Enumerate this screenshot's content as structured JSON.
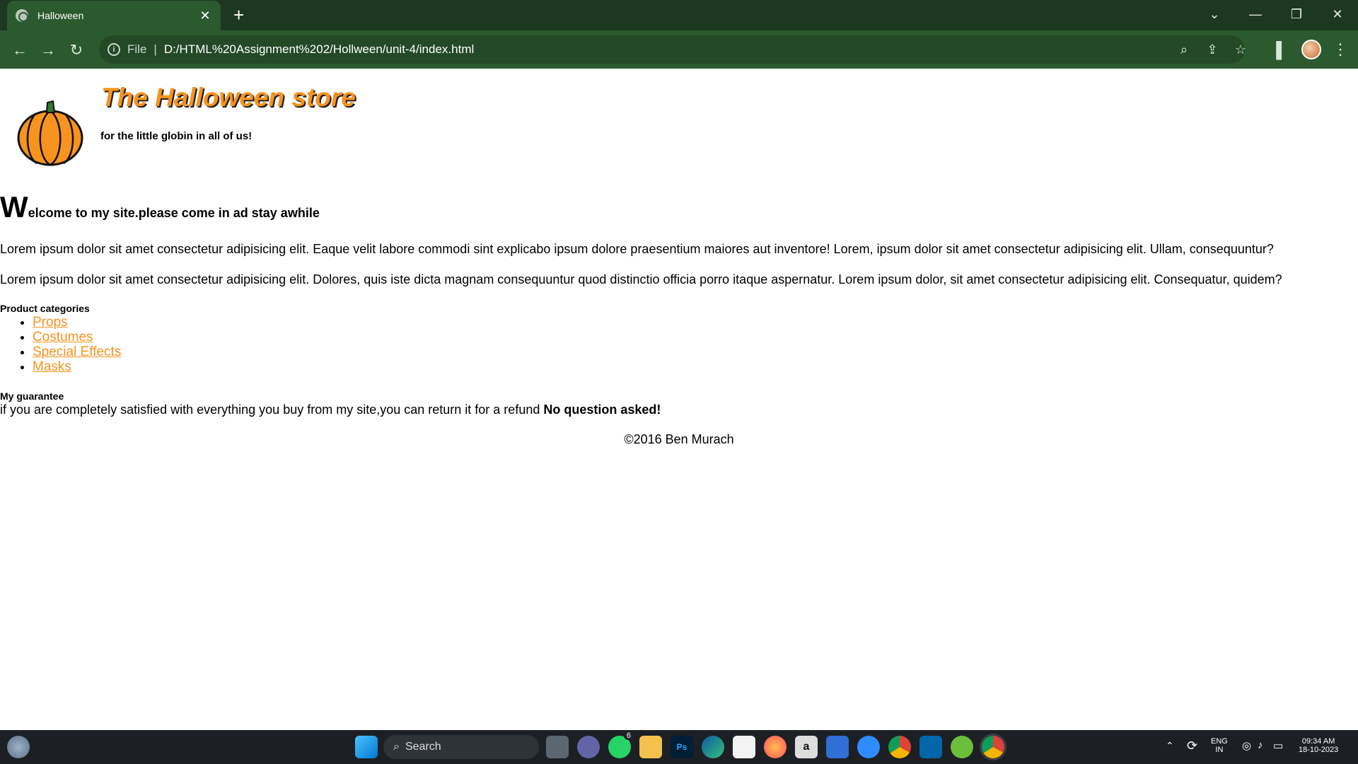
{
  "browser": {
    "tab_title": "Halloween",
    "new_tab_label": "+",
    "close_tab_label": "✕",
    "omnibox_scheme": "File",
    "url": "D:/HTML%20Assignment%202/Hollween/unit-4/index.html"
  },
  "page": {
    "store_title": "The Halloween store",
    "tagline": "for the little globin in all of us!",
    "welcome_first": "W",
    "welcome_rest": "elcome to my site.please come in ad stay awhile",
    "para1": "Lorem ipsum dolor sit amet consectetur adipisicing elit. Eaque velit labore commodi sint explicabo ipsum dolore praesentium maiores aut inventore! Lorem, ipsum dolor sit amet consectetur adipisicing elit. Ullam, consequuntur?",
    "para2": "Lorem ipsum dolor sit amet consectetur adipisicing elit. Dolores, quis iste dicta magnam consequuntur quod distinctio officia porro itaque aspernatur. Lorem ipsum dolor, sit amet consectetur adipisicing elit. Consequatur, quidem?",
    "categories_title": "Product categories",
    "categories": [
      "Props",
      "Costumes",
      "Special Effects",
      "Masks"
    ],
    "guarantee_title": "My guarantee",
    "guarantee_text": "if you are completely satisfied with everything you buy from my site,you can return it for a refund ",
    "guarantee_bold": "No question asked!",
    "copyright": "©2016 Ben Murach"
  },
  "taskbar": {
    "search_label": "Search",
    "whatsapp_badge": "6",
    "lang_line1": "ENG",
    "lang_line2": "IN",
    "time": "09:34 AM",
    "date": "18-10-2023"
  },
  "colors": {
    "chrome_dark": "#1d3820",
    "chrome_tab": "#2b5a2f",
    "accent_orange": "#f7931e"
  }
}
